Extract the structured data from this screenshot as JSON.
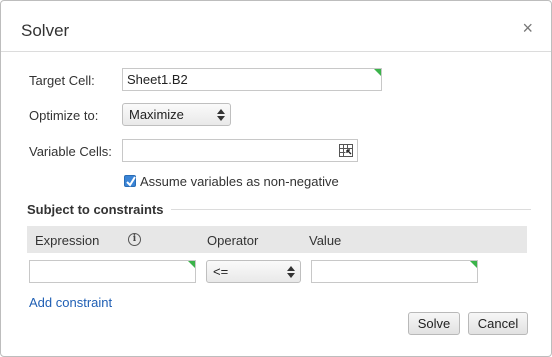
{
  "dialog": {
    "title": "Solver",
    "close_glyph": "×"
  },
  "form": {
    "target_cell_label": "Target Cell:",
    "target_cell_value": "Sheet1.B2",
    "optimize_label": "Optimize to:",
    "optimize_value": "Maximize",
    "variable_cells_label": "Variable Cells:",
    "variable_cells_value": "",
    "nonnegative_label": "Assume variables as non-negative",
    "nonnegative_checked": true
  },
  "constraints": {
    "section_title": "Subject to constraints",
    "columns": {
      "expression": "Expression",
      "operator": "Operator",
      "value": "Value"
    },
    "rows": [
      {
        "expression": "",
        "operator": "<=",
        "value": ""
      }
    ],
    "add_label": "Add constraint"
  },
  "buttons": {
    "solve": "Solve",
    "cancel": "Cancel"
  },
  "colors": {
    "accent_green": "#3bb34a",
    "link_blue": "#1f5fb4",
    "checkbox_blue": "#3a84d6"
  },
  "icons": {
    "close": "close-icon",
    "info": "info-icon",
    "cell_picker": "cell-range-picker-icon",
    "checkmark": "checkmark-icon"
  }
}
